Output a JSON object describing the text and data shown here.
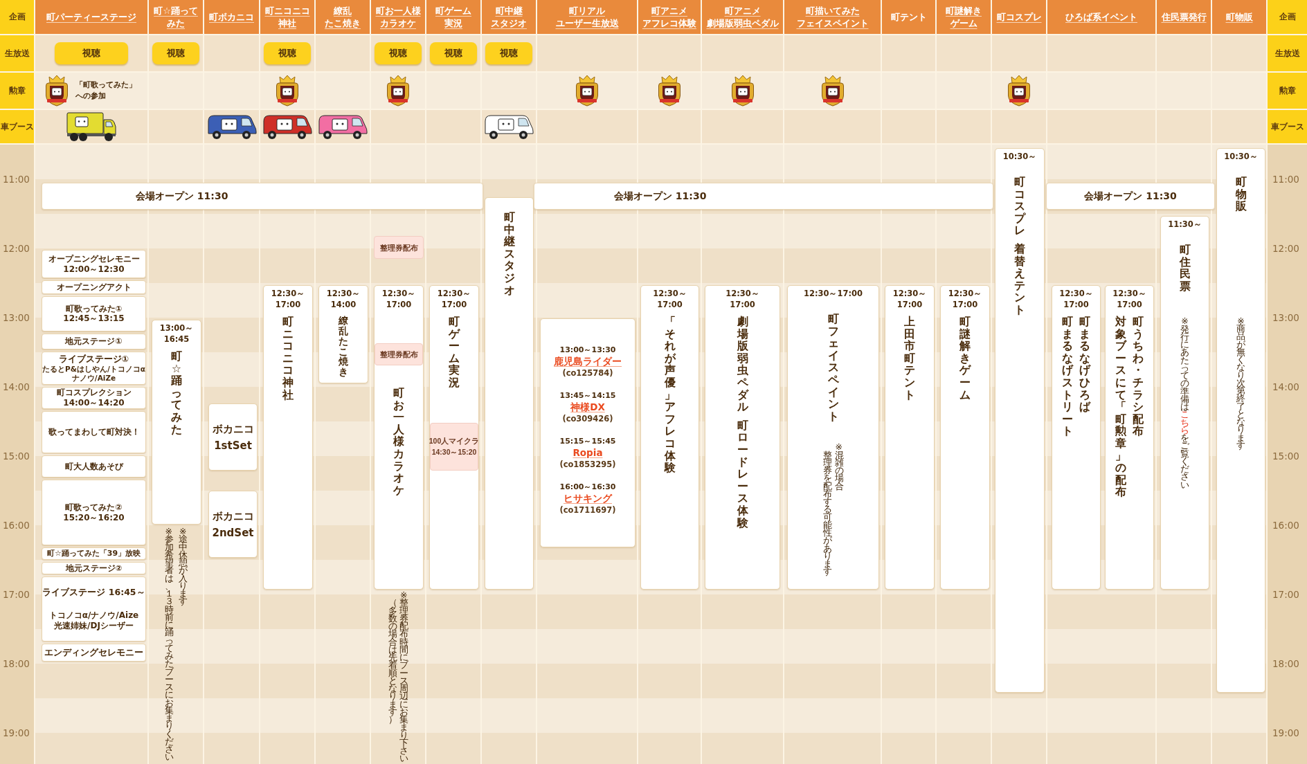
{
  "row_labels_left": [
    "企画",
    "生放送",
    "勲章",
    "車ブース"
  ],
  "row_labels_right": [
    "企画",
    "生放送",
    "勲章",
    "車ブース"
  ],
  "columns": [
    {
      "title": [
        "町パーティーステージ"
      ],
      "linked": true,
      "live_button": "視聴",
      "medal": true,
      "medal_note": [
        "「町歌ってみた」",
        "への参加"
      ],
      "car": {
        "kind": "truck",
        "color": "#e3dc31"
      },
      "events": [
        {
          "kind": "program_list",
          "items": [
            {
              "lines": [
                "オープニングセレモニー",
                "12:00～12:30"
              ]
            },
            {
              "lines": [
                "オープニングアクト"
              ]
            },
            {
              "lines": [
                "町歌ってみた①",
                "12:45～13:15"
              ]
            },
            {
              "lines": [
                "地元ステージ①"
              ]
            },
            {
              "lines": [
                "ライブステージ①",
                "たるとP&はしやん/トコノコα",
                "ナノウ/AiZe"
              ]
            },
            {
              "lines": [
                "町コスプレクション",
                "14:00～14:20"
              ]
            },
            {
              "lines": [
                "歌ってまわして町対決！"
              ]
            },
            {
              "lines": [
                "町大人数あそび"
              ]
            },
            {
              "lines": [
                "町歌ってみた②",
                "15:20～16:20"
              ]
            },
            {
              "lines": [
                "町☆踊ってみた「39」放映"
              ]
            },
            {
              "lines": [
                "地元ステージ②"
              ]
            },
            {
              "lines": [
                "ライブステージ 16:45～",
                "トコノコα/ナノウ/Aize",
                "光速姉妹/DJシーザー"
              ]
            },
            {
              "lines": [
                "エンディングセレモニー"
              ]
            }
          ]
        }
      ]
    },
    {
      "title": [
        "町☆踊って",
        "みた"
      ],
      "linked": true,
      "live_button": "視聴",
      "medal": false,
      "events": [
        {
          "kind": "block",
          "parts": [
            {
              "kind": "time",
              "lines": [
                "13:00～",
                "16:45"
              ]
            },
            {
              "kind": "title",
              "columns": [
                "町☆踊ってみた"
              ]
            }
          ]
        },
        {
          "kind": "note",
          "columns": [
            {
              "text": "※参加希望者は、１３時前に踊ってみたブースにお集まりください"
            },
            {
              "text": "※途中休憩が入ります"
            }
          ]
        }
      ]
    },
    {
      "title": [
        "町ボカニコ"
      ],
      "linked": true,
      "medal": false,
      "car": {
        "kind": "van",
        "color": "#3c5fb5"
      },
      "events": [
        {
          "kind": "block",
          "parts": [
            {
              "kind": "label",
              "lines": [
                "ボカニコ",
                "1stSet"
              ]
            }
          ]
        },
        {
          "kind": "block",
          "parts": [
            {
              "kind": "label",
              "lines": [
                "ボカニコ",
                "2ndSet"
              ]
            }
          ]
        }
      ]
    },
    {
      "title": [
        "町ニコニコ",
        "神社"
      ],
      "linked": true,
      "live_button": "視聴",
      "medal": true,
      "car": {
        "kind": "van",
        "color": "#cf2f28"
      },
      "events": [
        {
          "kind": "block",
          "parts": [
            {
              "kind": "time",
              "lines": [
                "12:30～",
                "17:00"
              ]
            },
            {
              "kind": "title",
              "columns": [
                "町ニコニコ神社"
              ]
            }
          ]
        }
      ]
    },
    {
      "title": [
        "繚乱",
        "たこ焼き"
      ],
      "linked": true,
      "medal": false,
      "car": {
        "kind": "van",
        "color": "#f26ea3"
      },
      "events": [
        {
          "kind": "block",
          "parts": [
            {
              "kind": "time",
              "lines": [
                "12:30～",
                "14:00"
              ]
            },
            {
              "kind": "title",
              "columns": [
                "繚乱たこ焼き"
              ]
            }
          ]
        }
      ]
    },
    {
      "title": [
        "町お一人様",
        "カラオケ"
      ],
      "linked": true,
      "live_button": "視聴",
      "medal": true,
      "events": [
        {
          "kind": "tag",
          "lines": [
            "整理券配布"
          ]
        },
        {
          "kind": "block",
          "parts": [
            {
              "kind": "time",
              "lines": [
                "12:30～",
                "17:00"
              ]
            },
            {
              "kind": "tag",
              "lines": [
                "整理券配布"
              ]
            },
            {
              "kind": "title",
              "columns": [
                "町お一人様カラオケ"
              ]
            }
          ]
        },
        {
          "kind": "note",
          "columns": [
            {
              "text": "（多数の場合は先着順となります）"
            },
            {
              "text": "※整理券配布時間にブース周辺にお集まり下さい"
            }
          ]
        }
      ]
    },
    {
      "title": [
        "町ゲーム",
        "実況"
      ],
      "linked": true,
      "live_button": "視聴",
      "medal": false,
      "events": [
        {
          "kind": "block",
          "parts": [
            {
              "kind": "time",
              "lines": [
                "12:30～",
                "17:00"
              ]
            },
            {
              "kind": "title",
              "columns": [
                "町ゲーム実況"
              ]
            },
            {
              "kind": "tag",
              "lines": [
                "100人マイクラ",
                "14:30～15:20"
              ]
            }
          ]
        }
      ]
    },
    {
      "title": [
        "町中継",
        "スタジオ"
      ],
      "linked": true,
      "live_button": "視聴",
      "medal": false,
      "car": {
        "kind": "van",
        "color": "#ffffff"
      },
      "events": [
        {
          "kind": "block",
          "parts": [
            {
              "kind": "title",
              "columns": [
                "町中継スタジオ"
              ]
            }
          ]
        }
      ]
    },
    {
      "title": [
        "町リアル",
        "ユーザー生放送"
      ],
      "linked": true,
      "medal": true,
      "events": [
        {
          "kind": "block",
          "parts": [
            {
              "kind": "lineup",
              "items": [
                {
                  "time": "13:00～13:30",
                  "name": "鹿児島ライダー",
                  "code": "(co125784)"
                },
                {
                  "time": "13:45～14:15",
                  "name": "神様DX",
                  "code": "(co309426)"
                },
                {
                  "time": "15:15～15:45",
                  "name": "Ropia",
                  "code": "(co1853295)"
                },
                {
                  "time": "16:00～16:30",
                  "name": "ヒサキング",
                  "code": "(co1711697)"
                }
              ]
            }
          ]
        }
      ]
    },
    {
      "title": [
        "町アニメ",
        "アフレコ体験"
      ],
      "linked": true,
      "medal": true,
      "events": [
        {
          "kind": "block",
          "parts": [
            {
              "kind": "time",
              "lines": [
                "12:30～",
                "17:00"
              ]
            },
            {
              "kind": "title",
              "columns": [
                "「それが声優」アフレコ体験"
              ]
            }
          ]
        }
      ]
    },
    {
      "title": [
        "町アニメ",
        "劇場版弱虫ペダル"
      ],
      "linked": true,
      "medal": true,
      "events": [
        {
          "kind": "block",
          "parts": [
            {
              "kind": "time",
              "lines": [
                "12:30～",
                "17:00"
              ]
            },
            {
              "kind": "title",
              "columns": [
                "劇場版弱虫ペダル"
              ]
            },
            {
              "kind": "title",
              "columns": [
                "町ロードレース体験"
              ]
            }
          ]
        }
      ]
    },
    {
      "title": [
        "町描いてみた",
        "フェイスペイント"
      ],
      "linked": true,
      "medal": true,
      "events": [
        {
          "kind": "block",
          "parts": [
            {
              "kind": "time",
              "lines": [
                "12:30～17:00"
              ]
            },
            {
              "kind": "title",
              "columns": [
                "町フェイスペイント"
              ]
            },
            {
              "kind": "note",
              "columns": [
                {
                  "text": "整理券を配布する可能性があります"
                },
                {
                  "text": "※混雑の場合"
                }
              ]
            }
          ]
        }
      ]
    },
    {
      "title": [
        "町テント"
      ],
      "linked": false,
      "medal": false,
      "events": [
        {
          "kind": "block",
          "parts": [
            {
              "kind": "time",
              "lines": [
                "12:30～",
                "17:00"
              ]
            },
            {
              "kind": "title",
              "columns": [
                "上田市町テント"
              ]
            }
          ]
        }
      ]
    },
    {
      "title": [
        "町謎解き",
        "ゲーム"
      ],
      "linked": true,
      "medal": false,
      "events": [
        {
          "kind": "block",
          "parts": [
            {
              "kind": "time",
              "lines": [
                "12:30～",
                "17:00"
              ]
            },
            {
              "kind": "title",
              "columns": [
                "町謎解きゲーム"
              ]
            }
          ]
        }
      ]
    },
    {
      "title": [
        "町コスプレ"
      ],
      "linked": true,
      "medal": true,
      "events": [
        {
          "kind": "block",
          "parts": [
            {
              "kind": "time",
              "lines": [
                "10:30～"
              ]
            },
            {
              "kind": "title",
              "columns": [
                "町コスプレ"
              ]
            },
            {
              "kind": "title",
              "columns": [
                "着替えテント"
              ]
            }
          ]
        }
      ]
    },
    {
      "title": [
        "ひろば系イベント"
      ],
      "linked": true,
      "medal": false,
      "events": [
        {
          "kind": "block",
          "parts": [
            {
              "kind": "time",
              "lines": [
                "12:30～",
                "17:00"
              ]
            },
            {
              "kind": "title",
              "columns": [
                "町まるなげストリート",
                "町まるなげひろば"
              ]
            }
          ]
        },
        {
          "kind": "block",
          "parts": [
            {
              "kind": "time",
              "lines": [
                "12:30～",
                "17:00"
              ]
            },
            {
              "kind": "title",
              "columns": [
                "対象ブースにて「町勲章」の配布",
                "町うちわ・チラシ配布"
              ]
            }
          ]
        }
      ]
    },
    {
      "title": [
        "住民票発行"
      ],
      "linked": true,
      "medal": false,
      "events": [
        {
          "kind": "block",
          "parts": [
            {
              "kind": "time",
              "lines": [
                "11:30～"
              ]
            },
            {
              "kind": "title",
              "columns": [
                "町住民票"
              ]
            },
            {
              "kind": "note",
              "columns": [
                {
                  "text": "※発行にあたっての準備は",
                  "link": "こちら",
                  "after": "をご覧ください"
                }
              ]
            }
          ]
        }
      ]
    },
    {
      "title": [
        "町物販"
      ],
      "linked": true,
      "medal": false,
      "events": [
        {
          "kind": "block",
          "parts": [
            {
              "kind": "time",
              "lines": [
                "10:30～"
              ]
            },
            {
              "kind": "title",
              "columns": [
                "町物販"
              ]
            },
            {
              "kind": "note",
              "columns": [
                {
                  "text": "※商品が無くなり次第終了となります"
                }
              ]
            }
          ]
        }
      ]
    }
  ],
  "open_banners": [
    "会場オープン 11:30",
    "会場オープン 11:30",
    "会場オープン 11:30"
  ],
  "times_left": [
    "11:00",
    "12:00",
    "13:00",
    "14:00",
    "15:00",
    "16:00",
    "17:00",
    "18:00",
    "19:00"
  ],
  "times_right": [
    "11:00",
    "12:00",
    "13:00",
    "14:00",
    "15:00",
    "16:00",
    "17:00",
    "18:00",
    "19:00"
  ]
}
